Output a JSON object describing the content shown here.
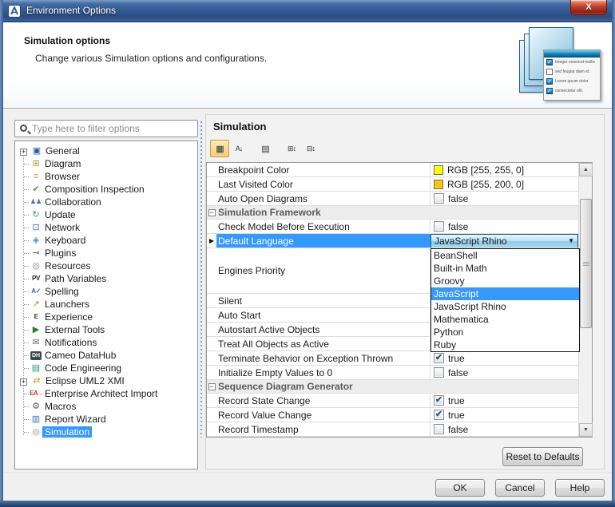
{
  "window": {
    "title": "Environment Options",
    "close_label": "X"
  },
  "header": {
    "title": "Simulation options",
    "description": "Change various Simulation options and configurations.",
    "graphic_checklist": [
      {
        "label": "Integer euismod mollis",
        "checked": true
      },
      {
        "label": "sed feugiat diam et.",
        "checked": false
      },
      {
        "label": "Lorem ipsum dolor",
        "checked": true
      },
      {
        "label": "consectetur elit.",
        "checked": true
      }
    ]
  },
  "sidebar": {
    "filter_placeholder": "Type here to filter options",
    "items": [
      {
        "label": "General",
        "icon": "general-icon",
        "glyph": "▣",
        "color": "#2d5b9e",
        "expandable": true
      },
      {
        "label": "Diagram",
        "icon": "diagram-icon",
        "glyph": "⊞",
        "color": "#9aa23a"
      },
      {
        "label": "Browser",
        "icon": "browser-icon",
        "glyph": "≡",
        "color": "#c9a23e"
      },
      {
        "label": "Composition Inspection",
        "icon": "composition-inspection-icon",
        "glyph": "✔",
        "color": "#4d9e3a"
      },
      {
        "label": "Collaboration",
        "icon": "collaboration-icon",
        "glyph": "♟♟",
        "color": "#3f6fb5"
      },
      {
        "label": "Update",
        "icon": "update-icon",
        "glyph": "↻",
        "color": "#2e9690"
      },
      {
        "label": "Network",
        "icon": "network-icon",
        "glyph": "⊡",
        "color": "#3a6cb0"
      },
      {
        "label": "Keyboard",
        "icon": "keyboard-icon",
        "glyph": "◈",
        "color": "#3aa0c8"
      },
      {
        "label": "Plugins",
        "icon": "plugins-icon",
        "glyph": "⊸",
        "color": "#555555"
      },
      {
        "label": "Resources",
        "icon": "resources-icon",
        "glyph": "◎",
        "color": "#808080"
      },
      {
        "label": "Path Variables",
        "icon": "path-variables-icon",
        "glyph": "PV",
        "color": "#222222",
        "text_icon": true
      },
      {
        "label": "Spelling",
        "icon": "spelling-icon",
        "glyph": "A✓",
        "color": "#2f62b0",
        "text_icon": true
      },
      {
        "label": "Launchers",
        "icon": "launchers-icon",
        "glyph": "↗",
        "color": "#b8902e"
      },
      {
        "label": "Experience",
        "icon": "experience-icon",
        "glyph": "E",
        "color": "#333333",
        "text_icon": true
      },
      {
        "label": "External Tools",
        "icon": "external-tools-icon",
        "glyph": "▶",
        "color": "#2d7d2d"
      },
      {
        "label": "Notifications",
        "icon": "notifications-icon",
        "glyph": "✉",
        "color": "#6a6a6a"
      },
      {
        "label": "Cameo DataHub",
        "icon": "cameo-datahub-icon",
        "glyph": "DH",
        "color": "#ffffff",
        "bg": "#3d4a52"
      },
      {
        "label": "Code Engineering",
        "icon": "code-engineering-icon",
        "glyph": "▤",
        "color": "#2e8f8f"
      },
      {
        "label": "Eclipse UML2 XMI",
        "icon": "eclipse-uml2-xmi-icon",
        "glyph": "⇄",
        "color": "#c9a23e",
        "expandable": true
      },
      {
        "label": "Enterprise Architect Import",
        "icon": "enterprise-architect-import-icon",
        "glyph": "EA→",
        "color": "#c0392b",
        "text_icon": true
      },
      {
        "label": "Macros",
        "icon": "macros-icon",
        "glyph": "⚙",
        "color": "#555555"
      },
      {
        "label": "Report Wizard",
        "icon": "report-wizard-icon",
        "glyph": "▥",
        "color": "#3f6fb5"
      },
      {
        "label": "Simulation",
        "icon": "simulation-icon",
        "glyph": "◎",
        "color": "#8a8a8a",
        "selected": true
      }
    ]
  },
  "content": {
    "title": "Simulation",
    "toolbar": [
      {
        "name": "categorized-view-icon",
        "glyph": "▦",
        "selected": true
      },
      {
        "name": "sort-alphabetically-icon",
        "glyph": "A↓",
        "selected": false
      },
      {
        "name": "show-description-icon",
        "glyph": "▤",
        "selected": false,
        "gap": true
      },
      {
        "name": "expand-all-icon",
        "glyph": "⊞↕",
        "selected": false,
        "gap": true
      },
      {
        "name": "collapse-all-icon",
        "glyph": "⊟↕",
        "selected": false
      }
    ],
    "rows": [
      {
        "type": "property",
        "label": "Breakpoint Color",
        "value_type": "color",
        "value": "RGB [255, 255, 0]",
        "swatch": "#ffff00"
      },
      {
        "type": "property",
        "label": "Last Visited Color",
        "value_type": "color",
        "value": "RGB [255, 200, 0]",
        "swatch": "#ffc800"
      },
      {
        "type": "property",
        "label": "Auto Open Diagrams",
        "value_type": "checkbox",
        "value": "false",
        "checked": false
      },
      {
        "type": "section",
        "label": "Simulation Framework"
      },
      {
        "type": "property",
        "label": "Check Model Before Execution",
        "value_type": "checkbox",
        "value": "false",
        "checked": false
      },
      {
        "type": "property",
        "label": "Default Language",
        "value_type": "combobox",
        "value": "JavaScript Rhino",
        "selected_row": true
      },
      {
        "type": "property",
        "label": "Engines Priority",
        "value_type": "hidden",
        "tall": true
      },
      {
        "type": "property",
        "label": "Silent",
        "value_type": "hidden"
      },
      {
        "type": "property",
        "label": "Auto Start",
        "value_type": "hidden"
      },
      {
        "type": "property",
        "label": "Autostart Active Objects",
        "value_type": "hidden"
      },
      {
        "type": "property",
        "label": "Treat All Objects as Active",
        "value_type": "hidden"
      },
      {
        "type": "property",
        "label": "Terminate Behavior on Exception Thrown",
        "value_type": "checkbox",
        "value": "true",
        "checked": true
      },
      {
        "type": "property",
        "label": "Initialize Empty Values to 0",
        "value_type": "checkbox",
        "value": "false",
        "checked": false
      },
      {
        "type": "section",
        "label": "Sequence Diagram Generator"
      },
      {
        "type": "property",
        "label": "Record State Change",
        "value_type": "checkbox",
        "value": "true",
        "checked": true
      },
      {
        "type": "property",
        "label": "Record Value Change",
        "value_type": "checkbox",
        "value": "true",
        "checked": true
      },
      {
        "type": "property",
        "label": "Record Timestamp",
        "value_type": "checkbox",
        "value": "false",
        "checked": false
      }
    ],
    "dropdown": {
      "options": [
        "BeanShell",
        "Built-in Math",
        "Groovy",
        "JavaScript",
        "JavaScript Rhino",
        "Mathematica",
        "Python",
        "Ruby"
      ],
      "highlighted": "JavaScript"
    },
    "reset_label": "Reset to Defaults"
  },
  "footer": {
    "ok": "OK",
    "cancel": "Cancel",
    "help": "Help"
  },
  "colors": {
    "selection": "#3399ff",
    "breakpoint_swatch": "#ffff00",
    "last_visited_swatch": "#ffc800"
  }
}
